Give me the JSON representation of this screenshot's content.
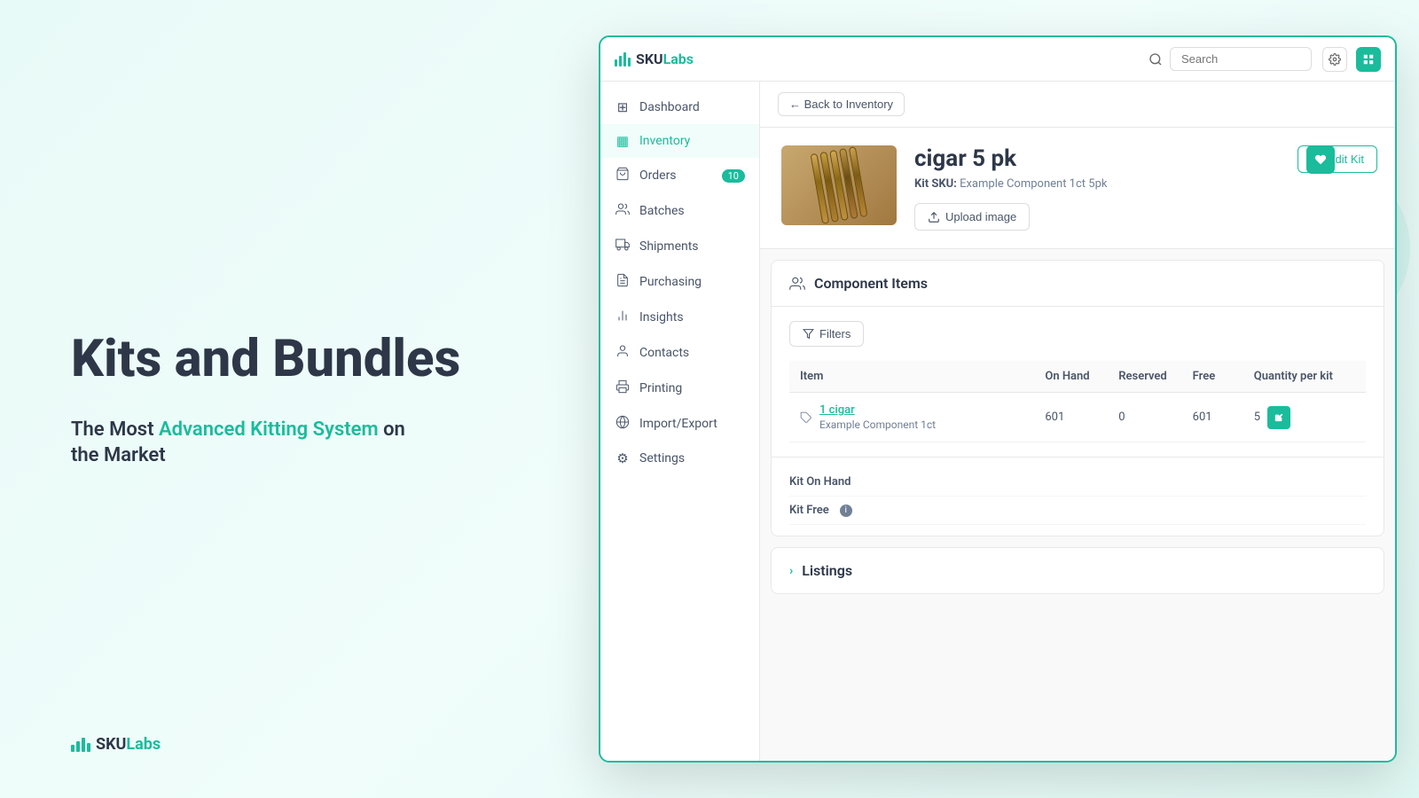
{
  "hero": {
    "title_1": "Kits and Bundles",
    "subtitle_1": "The Most",
    "subtitle_accent": "Advanced Kitting System",
    "subtitle_2": "on",
    "subtitle_3": "the Market"
  },
  "bottom_logo": {
    "text": "SKU",
    "brand": "Labs"
  },
  "app": {
    "logo": {
      "prefix": "SKU",
      "brand": "Labs"
    },
    "search": {
      "placeholder": "Search"
    },
    "breadcrumb": {
      "back_label": "← Back to Inventory"
    },
    "sidebar": {
      "items": [
        {
          "id": "dashboard",
          "label": "Dashboard",
          "icon": "⊞"
        },
        {
          "id": "inventory",
          "label": "Inventory",
          "icon": "▦",
          "active": true
        },
        {
          "id": "orders",
          "label": "Orders",
          "icon": "🛒",
          "badge": "10"
        },
        {
          "id": "batches",
          "label": "Batches",
          "icon": "⊕"
        },
        {
          "id": "shipments",
          "label": "Shipments",
          "icon": "🚚"
        },
        {
          "id": "purchasing",
          "label": "Purchasing",
          "icon": "📄"
        },
        {
          "id": "insights",
          "label": "Insights",
          "icon": "📊"
        },
        {
          "id": "contacts",
          "label": "Contacts",
          "icon": "👤"
        },
        {
          "id": "printing",
          "label": "Printing",
          "icon": "🖨"
        },
        {
          "id": "import_export",
          "label": "Import/Export",
          "icon": "⊙"
        },
        {
          "id": "settings",
          "label": "Settings",
          "icon": "⚙"
        }
      ]
    },
    "product": {
      "name": "cigar 5 pk",
      "sku_label": "Kit SKU:",
      "sku_value": "Example Component 1ct 5pk",
      "upload_btn": "Upload image",
      "edit_btn": "Edit Kit"
    },
    "component_items": {
      "section_title": "Component Items",
      "filters_btn": "Filters",
      "table": {
        "col_item": "Item",
        "col_onhand": "On Hand",
        "col_reserved": "Reserved",
        "col_free": "Free",
        "col_qty": "Quantity per kit",
        "rows": [
          {
            "name_link": "1 cigar",
            "sub": "Example Component 1ct",
            "on_hand": "601",
            "reserved": "0",
            "free": "601",
            "quantity": "5"
          }
        ]
      },
      "kit_on_hand_label": "Kit On Hand",
      "kit_free_label": "Kit Free"
    },
    "listings": {
      "section_title": "Listings"
    }
  }
}
